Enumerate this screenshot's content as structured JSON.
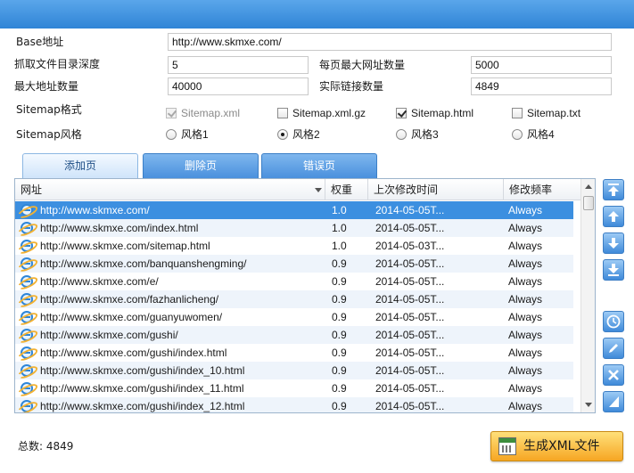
{
  "settings": {
    "base_label": "Base地址",
    "base_value": "http://www.skmxe.com/",
    "depth_label": "抓取文件目录深度",
    "depth_value": "5",
    "per_page_label": "每页最大网址数量",
    "per_page_value": "5000",
    "max_label": "最大地址数量",
    "max_value": "40000",
    "actual_label": "实际链接数量",
    "actual_value": "4849",
    "format_label": "Sitemap格式",
    "formats": [
      {
        "label": "Sitemap.xml",
        "checked": true,
        "disabled": true
      },
      {
        "label": "Sitemap.xml.gz",
        "checked": false,
        "disabled": false
      },
      {
        "label": "Sitemap.html",
        "checked": true,
        "disabled": false
      },
      {
        "label": "Sitemap.txt",
        "checked": false,
        "disabled": false
      }
    ],
    "style_label": "Sitemap风格",
    "styles": [
      {
        "label": "风格1",
        "selected": false
      },
      {
        "label": "风格2",
        "selected": true
      },
      {
        "label": "风格3",
        "selected": false
      },
      {
        "label": "风格4",
        "selected": false
      }
    ]
  },
  "tabs": [
    {
      "label": "添加页",
      "active": true
    },
    {
      "label": "删除页",
      "active": false
    },
    {
      "label": "错误页",
      "active": false
    }
  ],
  "table": {
    "columns": [
      "网址",
      "权重",
      "上次修改时间",
      "修改频率"
    ],
    "rows": [
      {
        "url": "http://www.skmxe.com/",
        "weight": "1.0",
        "modified": "2014-05-05T...",
        "freq": "Always"
      },
      {
        "url": "http://www.skmxe.com/index.html",
        "weight": "1.0",
        "modified": "2014-05-05T...",
        "freq": "Always"
      },
      {
        "url": "http://www.skmxe.com/sitemap.html",
        "weight": "1.0",
        "modified": "2014-05-03T...",
        "freq": "Always"
      },
      {
        "url": "http://www.skmxe.com/banquanshengming/",
        "weight": "0.9",
        "modified": "2014-05-05T...",
        "freq": "Always"
      },
      {
        "url": "http://www.skmxe.com/e/",
        "weight": "0.9",
        "modified": "2014-05-05T...",
        "freq": "Always"
      },
      {
        "url": "http://www.skmxe.com/fazhanlicheng/",
        "weight": "0.9",
        "modified": "2014-05-05T...",
        "freq": "Always"
      },
      {
        "url": "http://www.skmxe.com/guanyuwomen/",
        "weight": "0.9",
        "modified": "2014-05-05T...",
        "freq": "Always"
      },
      {
        "url": "http://www.skmxe.com/gushi/",
        "weight": "0.9",
        "modified": "2014-05-05T...",
        "freq": "Always"
      },
      {
        "url": "http://www.skmxe.com/gushi/index.html",
        "weight": "0.9",
        "modified": "2014-05-05T...",
        "freq": "Always"
      },
      {
        "url": "http://www.skmxe.com/gushi/index_10.html",
        "weight": "0.9",
        "modified": "2014-05-05T...",
        "freq": "Always"
      },
      {
        "url": "http://www.skmxe.com/gushi/index_11.html",
        "weight": "0.9",
        "modified": "2014-05-05T...",
        "freq": "Always"
      },
      {
        "url": "http://www.skmxe.com/gushi/index_12.html",
        "weight": "0.9",
        "modified": "2014-05-05T...",
        "freq": "Always"
      }
    ],
    "selected_row": 0,
    "row_icon": "ie-icon"
  },
  "side_buttons": [
    "move-top-icon",
    "move-up-icon",
    "move-down-icon",
    "move-bottom-icon",
    "clock-icon",
    "edit-icon",
    "delete-icon",
    "clear-icon"
  ],
  "footer": {
    "total_label": "总数: 4849",
    "generate_label": "生成XML文件"
  },
  "colors": {
    "titlebar": "#2f84d6",
    "selection": "#3c8fe0",
    "generate_button": "#f6a623"
  }
}
